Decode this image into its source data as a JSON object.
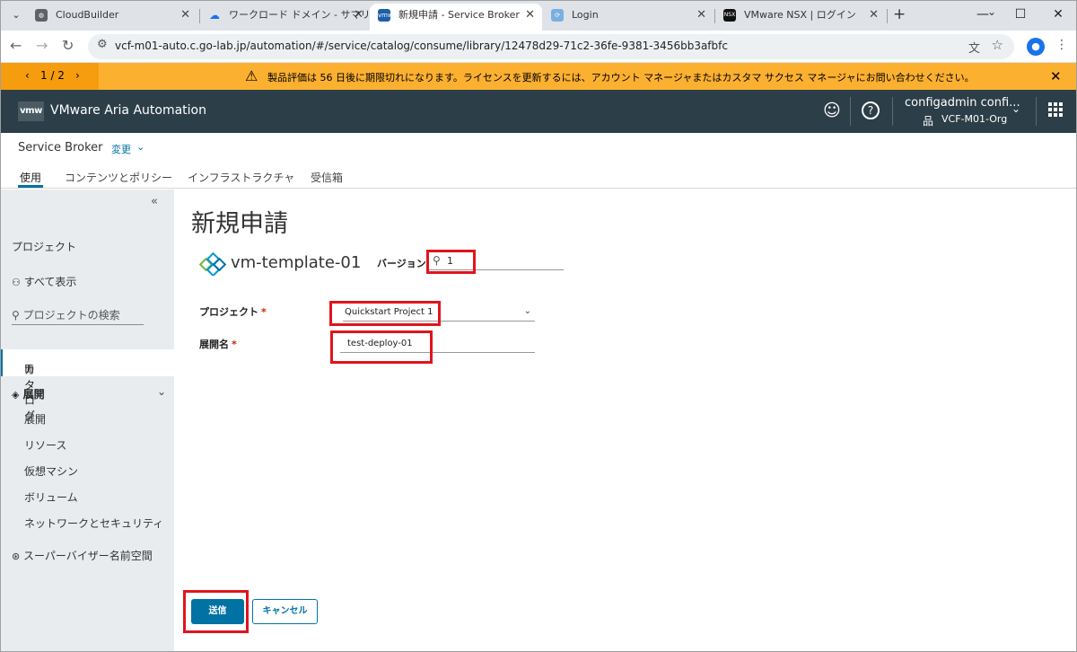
{
  "browser": {
    "tabs": [
      {
        "label": "CloudBuilder",
        "favicon": "globe-icon"
      },
      {
        "label": "ワークロード ドメイン - サマリ",
        "favicon": "cloud-icon"
      },
      {
        "label": "新規申請 - Service Broker",
        "favicon": "vmw-icon",
        "favicon_text": "vmw",
        "active": true
      },
      {
        "label": "Login",
        "favicon": "login-icon"
      },
      {
        "label": "VMware NSX | ログイン",
        "favicon": "nsx-icon",
        "favicon_text": "NSX"
      }
    ],
    "url": "vcf-m01-auto.c.go-lab.jp/automation/#/service/catalog/consume/library/12478d29-71c2-36fe-9381-3456bb3afbfc"
  },
  "banner": {
    "pager": "1 / 2",
    "message": "製品評価は 56 日後に期限切れになります。ライセンスを更新するには、アカウント マネージャまたはカスタマ サクセス マネージャにお問い合わせください。",
    "color": "#fcb030"
  },
  "header": {
    "logo": "vmw",
    "app_name": "VMware Aria Automation",
    "user": "configadmin confi...",
    "org": "VCF-M01-Org",
    "bg_color": "#2c3e48"
  },
  "subheader": {
    "service": "Service Broker",
    "change": "変更",
    "tabs": [
      "使用",
      "コンテンツとポリシー",
      "インフラストラクチャ",
      "受信箱"
    ]
  },
  "sidebar": {
    "projects_heading": "プロジェクト",
    "show_all": "すべて表示",
    "search_placeholder": "プロジェクトの検索",
    "catalog": "カタログ",
    "deploy_section": "展開",
    "deploy_items": [
      "展開",
      "リソース",
      "仮想マシン",
      "ボリューム",
      "ネットワークとセキュリティ"
    ],
    "supervisor": "スーパーバイザー名前空間"
  },
  "form": {
    "title": "新規申請",
    "blueprint_name": "vm-template-01",
    "version_label": "バージョン",
    "version_value": "1",
    "project_label": "プロジェクト",
    "project_value": "Quickstart Project 1",
    "deployment_label": "展開名",
    "deployment_value": "test-deploy-01",
    "required_mark": "*",
    "submit": "送信",
    "cancel": "キャンセル",
    "accent_color": "#0072a3",
    "highlight_color": "#e0141e"
  }
}
